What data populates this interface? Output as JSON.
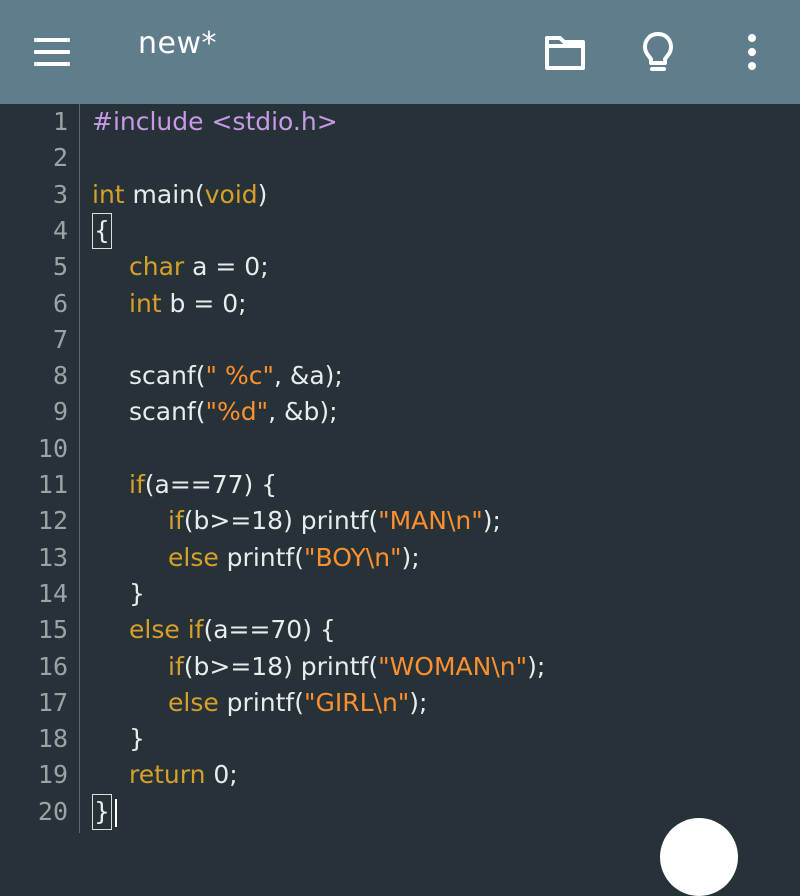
{
  "appbar": {
    "title": "new*",
    "icons": [
      "menu-icon",
      "folder-icon",
      "lightbulb-icon",
      "more-vert-icon"
    ]
  },
  "colors": {
    "appbar": "#607d8b",
    "editor_background": "#263238",
    "keyword": "#d6a02a",
    "preprocessor": "#c69ae6",
    "string": "#ff8f2d",
    "plain": "#e7ecee",
    "line_number": "#9aa3a8"
  },
  "editor": {
    "lines": [
      {
        "num": "1",
        "tokens": [
          {
            "t": "#include <stdio.h>",
            "c": "pp"
          }
        ]
      },
      {
        "num": "2",
        "tokens": []
      },
      {
        "num": "3",
        "tokens": [
          {
            "t": "int",
            "c": "kw"
          },
          {
            "t": " main(",
            "c": "pl"
          },
          {
            "t": "void",
            "c": "kw"
          },
          {
            "t": ")",
            "c": "pl"
          }
        ]
      },
      {
        "num": "4",
        "tokens": [
          {
            "t": "{",
            "c": "pl",
            "box": true
          }
        ]
      },
      {
        "num": "5",
        "indent": 1,
        "tokens": [
          {
            "t": "char",
            "c": "kw"
          },
          {
            "t": " a = 0;",
            "c": "pl"
          }
        ]
      },
      {
        "num": "6",
        "indent": 1,
        "tokens": [
          {
            "t": "int",
            "c": "kw"
          },
          {
            "t": " b = 0;",
            "c": "pl"
          }
        ]
      },
      {
        "num": "7",
        "tokens": []
      },
      {
        "num": "8",
        "indent": 1,
        "tokens": [
          {
            "t": "scanf(",
            "c": "pl"
          },
          {
            "t": "\" %c\"",
            "c": "str"
          },
          {
            "t": ", &a);",
            "c": "pl"
          }
        ]
      },
      {
        "num": "9",
        "indent": 1,
        "tokens": [
          {
            "t": "scanf(",
            "c": "pl"
          },
          {
            "t": "\"%d\"",
            "c": "str"
          },
          {
            "t": ", &b);",
            "c": "pl"
          }
        ]
      },
      {
        "num": "10",
        "tokens": []
      },
      {
        "num": "11",
        "indent": 1,
        "tokens": [
          {
            "t": "if",
            "c": "kw"
          },
          {
            "t": "(a==77) {",
            "c": "pl"
          }
        ]
      },
      {
        "num": "12",
        "indent": 2,
        "tokens": [
          {
            "t": "if",
            "c": "kw"
          },
          {
            "t": "(b>=18) printf(",
            "c": "pl"
          },
          {
            "t": "\"MAN\\n\"",
            "c": "str"
          },
          {
            "t": ");",
            "c": "pl"
          }
        ]
      },
      {
        "num": "13",
        "indent": 2,
        "tokens": [
          {
            "t": "else",
            "c": "kw"
          },
          {
            "t": " printf(",
            "c": "pl"
          },
          {
            "t": "\"BOY\\n\"",
            "c": "str"
          },
          {
            "t": ");",
            "c": "pl"
          }
        ]
      },
      {
        "num": "14",
        "indent": 1,
        "tokens": [
          {
            "t": "}",
            "c": "pl"
          }
        ]
      },
      {
        "num": "15",
        "indent": 1,
        "tokens": [
          {
            "t": "else",
            "c": "kw"
          },
          {
            "t": " ",
            "c": "pl"
          },
          {
            "t": "if",
            "c": "kw"
          },
          {
            "t": "(a==70) {",
            "c": "pl"
          }
        ]
      },
      {
        "num": "16",
        "indent": 2,
        "tokens": [
          {
            "t": "if",
            "c": "kw"
          },
          {
            "t": "(b>=18) printf(",
            "c": "pl"
          },
          {
            "t": "\"WOMAN\\n\"",
            "c": "str"
          },
          {
            "t": ");",
            "c": "pl"
          }
        ]
      },
      {
        "num": "17",
        "indent": 2,
        "tokens": [
          {
            "t": "else",
            "c": "kw"
          },
          {
            "t": " printf(",
            "c": "pl"
          },
          {
            "t": "\"GIRL\\n\"",
            "c": "str"
          },
          {
            "t": ");",
            "c": "pl"
          }
        ]
      },
      {
        "num": "18",
        "indent": 1,
        "tokens": [
          {
            "t": "}",
            "c": "pl"
          }
        ]
      },
      {
        "num": "19",
        "indent": 1,
        "tokens": [
          {
            "t": "return",
            "c": "kw"
          },
          {
            "t": " 0;",
            "c": "pl"
          }
        ]
      },
      {
        "num": "20",
        "tokens": [
          {
            "t": "}",
            "c": "pl",
            "box": true
          }
        ],
        "cursor": true
      }
    ]
  }
}
